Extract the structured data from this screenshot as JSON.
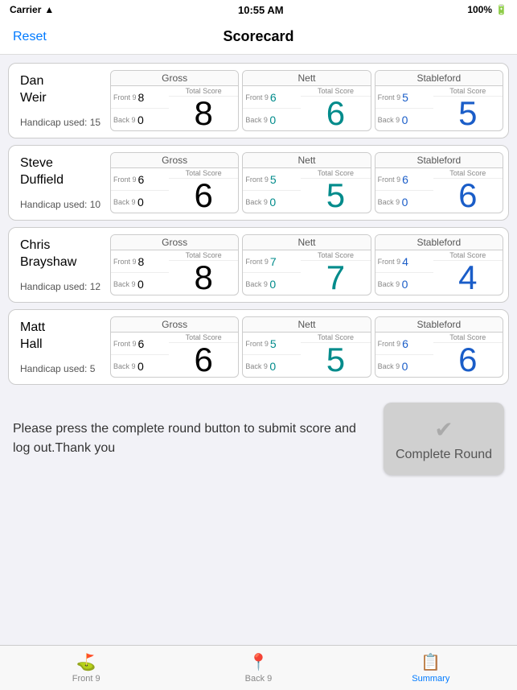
{
  "statusBar": {
    "carrier": "Carrier",
    "time": "10:55 AM",
    "battery": "100%"
  },
  "navBar": {
    "title": "Scorecard",
    "resetLabel": "Reset"
  },
  "players": [
    {
      "name": "Dan\nWeir",
      "handicap": "Handicap used: 15",
      "gross": {
        "header": "Gross",
        "front9Label": "Front 9",
        "front9Value": "8",
        "back9Label": "Back 9",
        "back9Value": "0",
        "totalLabel": "Total Score",
        "totalValue": "8"
      },
      "nett": {
        "header": "Nett",
        "front9Label": "Front 9",
        "front9Value": "6",
        "back9Label": "Back 9",
        "back9Value": "0",
        "totalLabel": "Total Score",
        "totalValue": "6"
      },
      "stableford": {
        "header": "Stableford",
        "front9Label": "Front 9",
        "front9Value": "5",
        "back9Label": "Back 9",
        "back9Value": "0",
        "totalLabel": "Total Score",
        "totalValue": "5"
      }
    },
    {
      "name": "Steve\nDuffield",
      "handicap": "Handicap used: 10",
      "gross": {
        "header": "Gross",
        "front9Label": "Front 9",
        "front9Value": "6",
        "back9Label": "Back 9",
        "back9Value": "0",
        "totalLabel": "Total Score",
        "totalValue": "6"
      },
      "nett": {
        "header": "Nett",
        "front9Label": "Front 9",
        "front9Value": "5",
        "back9Label": "Back 9",
        "back9Value": "0",
        "totalLabel": "Total Score",
        "totalValue": "5"
      },
      "stableford": {
        "header": "Stableford",
        "front9Label": "Front 9",
        "front9Value": "6",
        "back9Label": "Back 9",
        "back9Value": "0",
        "totalLabel": "Total Score",
        "totalValue": "6"
      }
    },
    {
      "name": "Chris\nBrayshaw",
      "handicap": "Handicap used: 12",
      "gross": {
        "header": "Gross",
        "front9Label": "Front 9",
        "front9Value": "8",
        "back9Label": "Back 9",
        "back9Value": "0",
        "totalLabel": "Total Score",
        "totalValue": "8"
      },
      "nett": {
        "header": "Nett",
        "front9Label": "Front 9",
        "front9Value": "7",
        "back9Label": "Back 9",
        "back9Value": "0",
        "totalLabel": "Total Score",
        "totalValue": "7"
      },
      "stableford": {
        "header": "Stableford",
        "front9Label": "Front 9",
        "front9Value": "4",
        "back9Label": "Back 9",
        "back9Value": "0",
        "totalLabel": "Total Score",
        "totalValue": "4"
      }
    },
    {
      "name": "Matt\nHall",
      "handicap": "Handicap used: 5",
      "gross": {
        "header": "Gross",
        "front9Label": "Front 9",
        "front9Value": "6",
        "back9Label": "Back 9",
        "back9Value": "0",
        "totalLabel": "Total Score",
        "totalValue": "6"
      },
      "nett": {
        "header": "Nett",
        "front9Label": "Front 9",
        "front9Value": "5",
        "back9Label": "Back 9",
        "back9Value": "0",
        "totalLabel": "Total Score",
        "totalValue": "5"
      },
      "stableford": {
        "header": "Stableford",
        "front9Label": "Front 9",
        "front9Value": "6",
        "back9Label": "Back 9",
        "back9Value": "0",
        "totalLabel": "Total Score",
        "totalValue": "6"
      }
    }
  ],
  "bottomText": "Please press the complete round button to submit score and log out.Thank you",
  "completeRoundLabel": "Complete Round",
  "tabs": [
    {
      "id": "front9",
      "label": "Front 9",
      "icon": "⛳",
      "active": false
    },
    {
      "id": "back9",
      "label": "Back 9",
      "icon": "📍",
      "active": false
    },
    {
      "id": "summary",
      "label": "Summary",
      "icon": "📋",
      "active": true
    }
  ]
}
